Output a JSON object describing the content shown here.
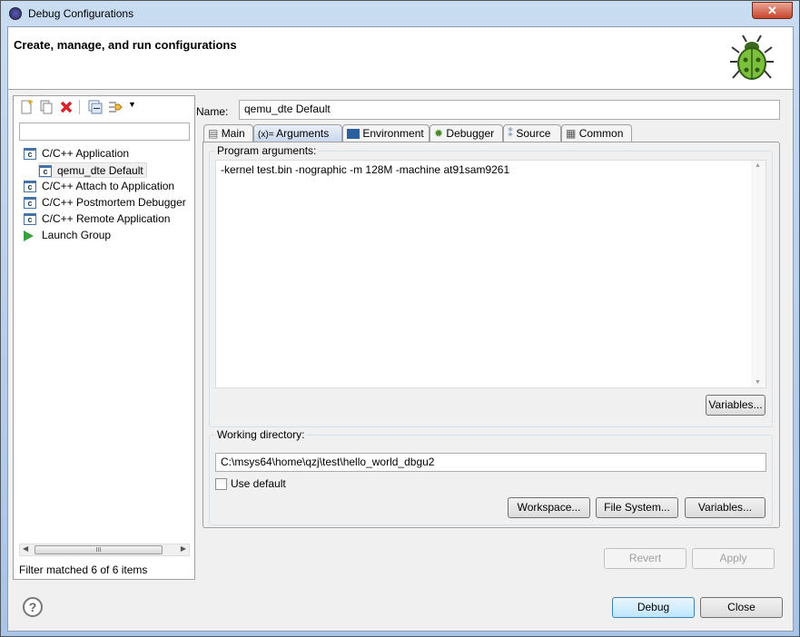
{
  "window": {
    "title": "Debug Configurations",
    "close": "✕"
  },
  "header": {
    "title": "Create, manage, and run configurations"
  },
  "left": {
    "filter_placeholder": "",
    "tree": [
      {
        "label": "C/C++ Application",
        "icon": "c-config-icon",
        "level": 0
      },
      {
        "label": "qemu_dte Default",
        "icon": "c-config-icon",
        "level": 1,
        "selected": true
      },
      {
        "label": "C/C++ Attach to Application",
        "icon": "c-config-icon",
        "level": 0
      },
      {
        "label": "C/C++ Postmortem Debugger",
        "icon": "c-config-icon",
        "level": 0
      },
      {
        "label": "C/C++ Remote Application",
        "icon": "c-config-icon",
        "level": 0
      },
      {
        "label": "Launch Group",
        "icon": "launch-group-icon",
        "level": 0
      }
    ],
    "status": "Filter matched 6 of 6 items",
    "scroll_grip": "III"
  },
  "right": {
    "name_label": "Name:",
    "name_value": "qemu_dte Default",
    "tabs": [
      {
        "label": "Main"
      },
      {
        "label": "Arguments",
        "selected": true
      },
      {
        "label": "Environment"
      },
      {
        "label": "Debugger"
      },
      {
        "label": "Source"
      },
      {
        "label": "Common"
      }
    ],
    "args_icon": "(x)=",
    "program_args_label": "Program arguments:",
    "program_args": "-kernel test.bin -nographic -m 128M -machine at91sam9261",
    "variables": "Variables...",
    "workdir_label": "Working directory:",
    "workdir": "C:\\msys64\\home\\qzj\\test\\hello_world_dbgu2",
    "use_default": "Use default",
    "use_default_checked": false,
    "workspace": "Workspace...",
    "filesystem": "File System...",
    "variables2": "Variables...",
    "revert": "Revert",
    "apply": "Apply"
  },
  "footer": {
    "help": "?",
    "debug": "Debug",
    "close": "Close"
  }
}
